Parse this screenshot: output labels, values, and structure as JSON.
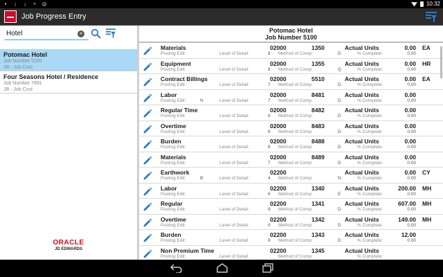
{
  "status_bar": {
    "time": "10:32"
  },
  "app": {
    "title": "Job Progress Entry"
  },
  "search": {
    "value": "Hotel",
    "clear_glyph": "×"
  },
  "results": [
    {
      "name": "Potomac Hotel",
      "job_number": "Job Number 5100",
      "type": "JB - Job Cost"
    },
    {
      "name": "Four Seasons Hotel / Residence",
      "job_number": "Job Number 7891",
      "type": "JB - Job Cost"
    }
  ],
  "branding": {
    "word": "ORACLE",
    "sub": "JD EDWARDS"
  },
  "detail": {
    "title": "Potomac Hotel",
    "subtitle": "Job Number 5100",
    "labels": {
      "posting_edit": "Posting Edit:",
      "level_of_detail": "Level of Detail:",
      "method_of_comp": "Method of Comp:",
      "actual_units": "Actual Units",
      "percent_complete": "% Complete:"
    },
    "rows": [
      {
        "name": "Materials",
        "code": "02000",
        "num": "1350",
        "actual": "0.00",
        "unit": "EA",
        "posting_edit": "",
        "level": "8",
        "method": "D",
        "percent": "0.00"
      },
      {
        "name": "Equipment",
        "code": "02000",
        "num": "1355",
        "actual": "0.00",
        "unit": "HR",
        "posting_edit": "",
        "level": "8",
        "method": "Q",
        "percent": "0.00"
      },
      {
        "name": "Contract Billings",
        "code": "02000",
        "num": "5510",
        "actual": "0.00",
        "unit": "EA",
        "posting_edit": "",
        "level": "7",
        "method": "D",
        "percent": "0.00"
      },
      {
        "name": "Labor",
        "code": "02000",
        "num": "8481",
        "actual": "0.00",
        "unit": "",
        "posting_edit": "N",
        "level": "7",
        "method": "D",
        "percent": "0.00"
      },
      {
        "name": "Regular Time",
        "code": "02000",
        "num": "8482",
        "actual": "0.00",
        "unit": "",
        "posting_edit": "",
        "level": "8",
        "method": "D",
        "percent": "0.00"
      },
      {
        "name": "Overtime",
        "code": "02000",
        "num": "8483",
        "actual": "0.00",
        "unit": "",
        "posting_edit": "",
        "level": "8",
        "method": "D",
        "percent": "0.00"
      },
      {
        "name": "Burden",
        "code": "02000",
        "num": "8488",
        "actual": "0.00",
        "unit": "",
        "posting_edit": "",
        "level": "8",
        "method": "D",
        "percent": "0.00"
      },
      {
        "name": "Materials",
        "code": "02000",
        "num": "8489",
        "actual": "0.00",
        "unit": "",
        "posting_edit": "",
        "level": "7",
        "method": "D",
        "percent": "0.00"
      },
      {
        "name": "Earthwork",
        "code": "02200",
        "num": "",
        "actual": "0.00",
        "unit": "CY",
        "posting_edit": "B",
        "level": "4",
        "method": "N",
        "percent": "0.00"
      },
      {
        "name": "Labor",
        "code": "02200",
        "num": "1340",
        "actual": "200.00",
        "unit": "MH",
        "posting_edit": "",
        "level": "8",
        "method": "E",
        "percent": "0.00"
      },
      {
        "name": "Regular",
        "code": "02200",
        "num": "1341",
        "actual": "607.00",
        "unit": "MH",
        "posting_edit": "",
        "level": "9",
        "method": "D",
        "percent": "0.00"
      },
      {
        "name": "Overtime",
        "code": "02200",
        "num": "1342",
        "actual": "149.00",
        "unit": "MH",
        "posting_edit": "",
        "level": "9",
        "method": "D",
        "percent": "0.00"
      },
      {
        "name": "Burden",
        "code": "02200",
        "num": "1343",
        "actual": "12.00",
        "unit": "",
        "posting_edit": "",
        "level": "9",
        "method": "D",
        "percent": "0.00"
      },
      {
        "name": "Non Premium Time",
        "code": "02200",
        "num": "1345",
        "actual": "",
        "unit": "",
        "posting_edit": "",
        "level": "",
        "method": "",
        "percent": ""
      }
    ]
  },
  "icons": {
    "app_logo": "jde-logo-icon",
    "filter": "filter-icon",
    "search": "search-icon",
    "edit": "pencil-icon",
    "back": "back-icon",
    "home": "home-icon",
    "recents": "recents-icon"
  },
  "colors": {
    "selected_row": "#a9d9f4",
    "accent": "#33a7d8",
    "icon_blue": "#2a7dc4",
    "oracle_red": "#e2001a"
  }
}
